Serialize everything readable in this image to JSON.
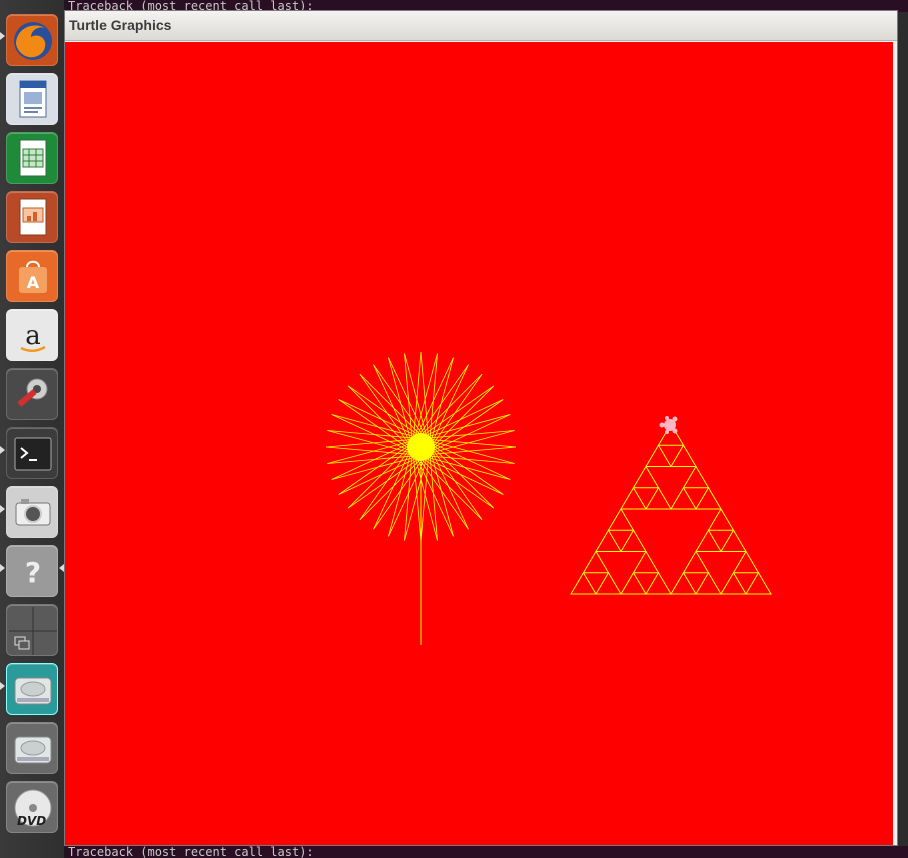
{
  "window": {
    "title": "Turtle Graphics"
  },
  "terminal": {
    "top_text": "Traceback (most recent call last):",
    "bottom_text": "Traceback (most recent call last):"
  },
  "launcher": {
    "items": [
      {
        "name": "firefox-icon"
      },
      {
        "name": "libreoffice-writer-icon"
      },
      {
        "name": "libreoffice-calc-icon"
      },
      {
        "name": "libreoffice-impress-icon"
      },
      {
        "name": "ubuntu-software-center-icon"
      },
      {
        "name": "amazon-icon"
      },
      {
        "name": "system-settings-icon"
      },
      {
        "name": "terminal-icon"
      },
      {
        "name": "camera-icon"
      },
      {
        "name": "help-icon"
      },
      {
        "name": "workspace-switcher-icon"
      },
      {
        "name": "drive-icon"
      },
      {
        "name": "drive-icon"
      },
      {
        "name": "dvd-icon"
      }
    ],
    "dvd_label": "DVD"
  },
  "canvas": {
    "background": "#ff0000",
    "pen_color": "#ffff00",
    "turtle_color": "#ffb6c1"
  }
}
